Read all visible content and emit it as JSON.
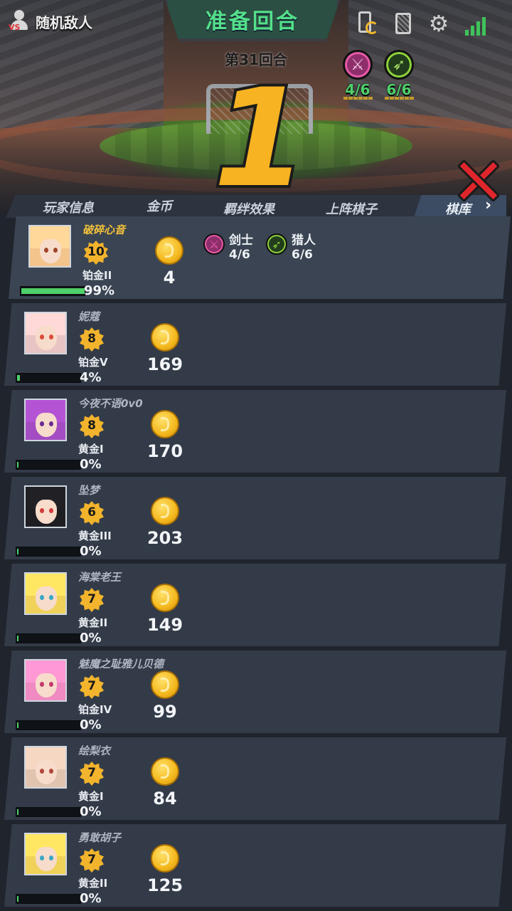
{
  "opponent": {
    "label": "随机敌人"
  },
  "phase": {
    "title": "准备回合",
    "round": "第31回合",
    "countdown": "1"
  },
  "top_icons": [
    "phone-rotate-icon",
    "cards-icon",
    "gear-icon",
    "signal-icon"
  ],
  "top_traits": [
    {
      "name": "swordsman",
      "count": "4/6",
      "color": "#8e2f6b",
      "ring": "#e75aa8",
      "text_color": "#4fd06a"
    },
    {
      "name": "hunter",
      "count": "6/6",
      "color": "#223d1c",
      "ring": "#8fd23c",
      "text_color": "#4fd06a"
    }
  ],
  "tabs": [
    "玩家信息",
    "金币",
    "羁绊效果",
    "上阵棋子",
    "棋库"
  ],
  "players": [
    {
      "name": "破碎心音",
      "level": "10",
      "rank": "铂金II",
      "hp": 99,
      "hp_text": "99%",
      "gold": "4",
      "me": true,
      "hair": "#f3c48c",
      "eyes": "#a1452a"
    },
    {
      "name": "妮蔻",
      "level": "8",
      "rank": "铂金V",
      "hp": 4,
      "hp_text": "4%",
      "gold": "169",
      "hair": "#e9c4c4",
      "eyes": "#d94a3a"
    },
    {
      "name": "今夜不语0v0",
      "level": "8",
      "rank": "黄金I",
      "hp": 0,
      "hp_text": "0%",
      "gold": "170",
      "hair": "#a44cc2",
      "eyes": "#6a2b8f"
    },
    {
      "name": "坠梦",
      "level": "6",
      "rank": "黄金III",
      "hp": 0,
      "hp_text": "0%",
      "gold": "203",
      "hair": "#1e1e22",
      "eyes": "#d23a3a"
    },
    {
      "name": "海棠老王",
      "level": "7",
      "rank": "黄金II",
      "hp": 0,
      "hp_text": "0%",
      "gold": "149",
      "hair": "#f0d25a",
      "eyes": "#38a7c4"
    },
    {
      "name": "魅魔之耻雅儿贝德",
      "level": "7",
      "rank": "铂金IV",
      "hp": 0,
      "hp_text": "0%",
      "gold": "99",
      "hair": "#f08ac2",
      "eyes": "#c23a6a"
    },
    {
      "name": "绘梨衣",
      "level": "7",
      "rank": "黄金I",
      "hp": 0,
      "hp_text": "0%",
      "gold": "84",
      "hair": "#e0c4b0",
      "eyes": "#b2473a"
    },
    {
      "name": "勇敢胡子",
      "level": "7",
      "rank": "黄金II",
      "hp": 0,
      "hp_text": "0%",
      "gold": "125",
      "hair": "#f0d25a",
      "eyes": "#38a7c4"
    }
  ],
  "my_traits": [
    {
      "name": "剑士",
      "count": "4/6",
      "color": "#8e2f6b",
      "ring": "#e75aa8",
      "icon": "sword-icon"
    },
    {
      "name": "猎人",
      "count": "6/6",
      "color": "#223d1c",
      "ring": "#8fd23c",
      "icon": "bow-icon"
    }
  ]
}
